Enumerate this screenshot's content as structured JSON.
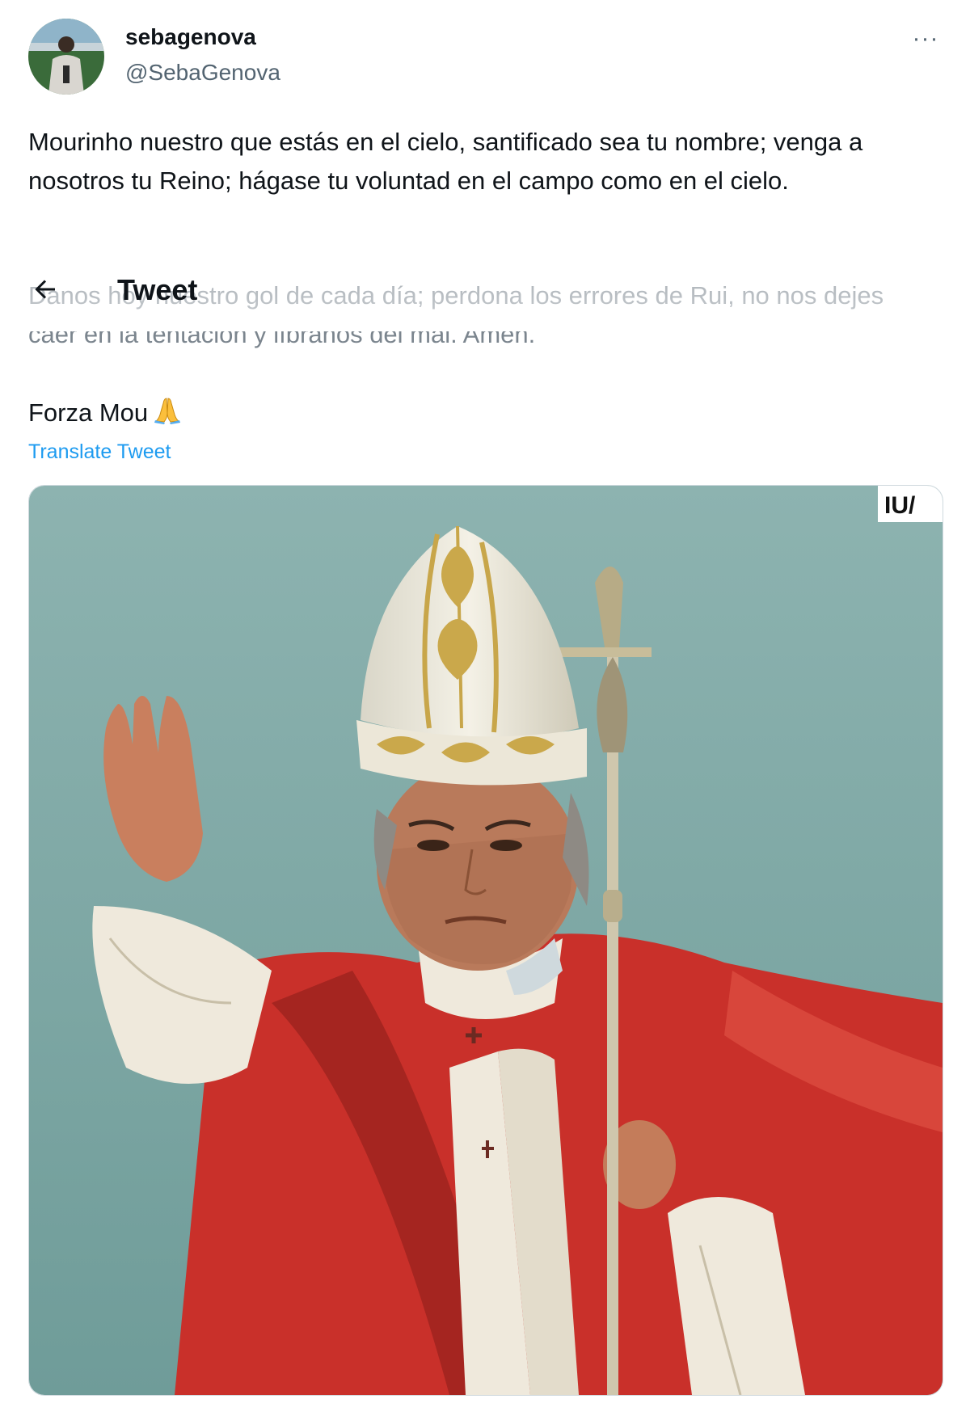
{
  "author": {
    "name": "sebagenova",
    "handle": "@SebaGenova"
  },
  "header": {
    "title": "Tweet"
  },
  "tweet": {
    "paragraph_1": "Mourinho nuestro que estás en el cielo, santificado sea tu nombre; venga a nosotros tu Reino; hágase tu voluntad en el campo como en el cielo.",
    "paragraph_2": "Danos hoy nuestro gol de cada día; perdona los errores de Rui, no nos dejes caer en la tentación y líbranos del mal. Amén.",
    "paragraph_3": "Forza Mou",
    "emoji": "pray-emoji"
  },
  "translate": {
    "label": "Translate Tweet"
  },
  "media": {
    "watermark": "IU/"
  },
  "icons": {
    "more": "more-icon",
    "back": "arrow-left-icon"
  },
  "colors": {
    "link": "#1d9bf0",
    "handle": "#536471",
    "sky": "#7fa9a6",
    "robe_red": "#c9302a"
  }
}
